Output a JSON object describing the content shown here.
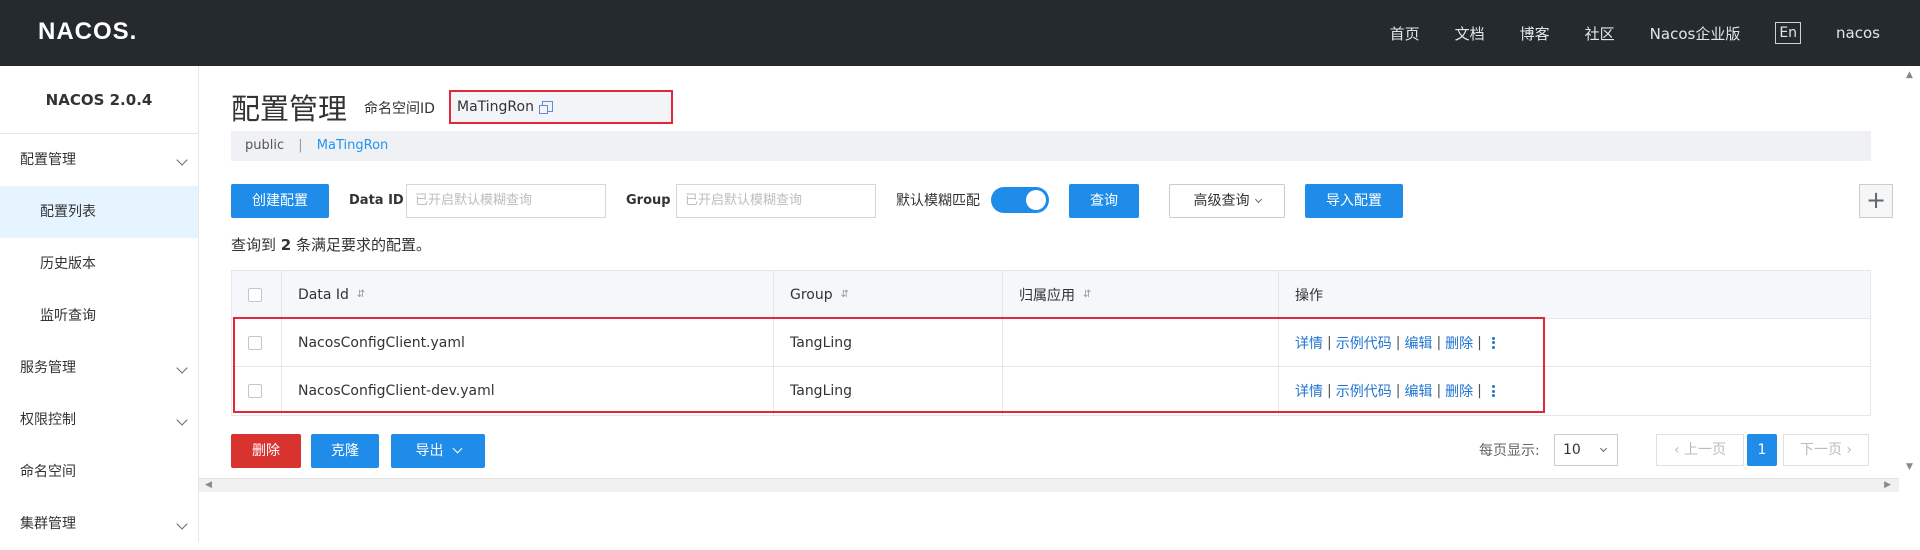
{
  "topbar": {
    "logo": "NACOS.",
    "nav": [
      "首页",
      "文档",
      "博客",
      "社区",
      "Nacos企业版",
      "En",
      "nacos"
    ]
  },
  "sidebar": {
    "version": "NACOS 2.0.4",
    "items": [
      {
        "label": "配置管理",
        "expandable": true
      },
      {
        "label": "配置列表",
        "active": true
      },
      {
        "label": "历史版本"
      },
      {
        "label": "监听查询"
      },
      {
        "label": "服务管理",
        "expandable": true
      },
      {
        "label": "权限控制",
        "expandable": true
      },
      {
        "label": "命名空间"
      },
      {
        "label": "集群管理",
        "expandable": true
      }
    ]
  },
  "header": {
    "title": "配置管理",
    "namespace_label": "命名空间ID",
    "namespace_id": "MaTingRon"
  },
  "breadcrumb": {
    "first": "public",
    "separator": "|",
    "second": "MaTingRon"
  },
  "toolbar": {
    "create_label": "创建配置",
    "dataid_label": "Data ID",
    "dataid_placeholder": "已开启默认模糊查询",
    "group_label": "Group",
    "group_placeholder": "已开启默认模糊查询",
    "fuzzy_label": "默认模糊匹配",
    "fuzzy_on": true,
    "query_label": "查询",
    "advanced_label": "高级查询",
    "import_label": "导入配置",
    "plus_label": "+"
  },
  "result": {
    "prefix": "查询到",
    "count": "2",
    "suffix": "条满足要求的配置。"
  },
  "table": {
    "columns": [
      "Data Id",
      "Group",
      "归属应用",
      "操作"
    ],
    "sort_icon": "⇵",
    "rows": [
      {
        "data_id": "NacosConfigClient.yaml",
        "group": "TangLing",
        "app": ""
      },
      {
        "data_id": "NacosConfigClient-dev.yaml",
        "group": "TangLing",
        "app": ""
      }
    ],
    "actions": [
      "详情",
      "示例代码",
      "编辑",
      "删除"
    ]
  },
  "footer": {
    "delete_label": "删除",
    "clone_label": "克隆",
    "export_label": "导出"
  },
  "pagination": {
    "per_page_label": "每页显示:",
    "per_page": "10",
    "prev_label": "上一页",
    "current": "1",
    "next_label": "下一页"
  },
  "colors": {
    "topbar_bg": "#252a2f",
    "primary": "#1e8ce8",
    "danger": "#d9332f",
    "highlight": "#e0283a"
  }
}
